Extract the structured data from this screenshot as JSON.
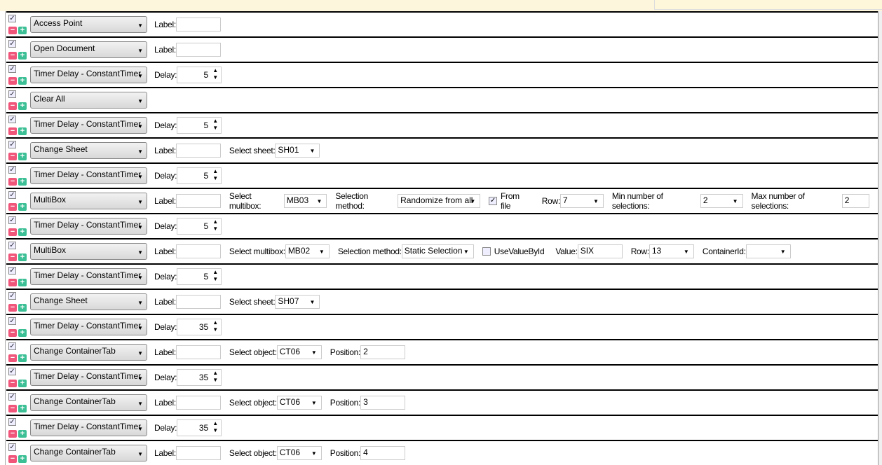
{
  "rows": [
    {
      "action": "Access Point",
      "fields": [
        {
          "type": "input",
          "label": "Label:",
          "value": "",
          "w": 64
        }
      ]
    },
    {
      "action": "Open Document",
      "fields": [
        {
          "type": "input",
          "label": "Label:",
          "value": "",
          "w": 64
        }
      ]
    },
    {
      "action": "Timer Delay - ConstantTimer",
      "fields": [
        {
          "type": "spin",
          "label": "Delay:",
          "value": "5"
        }
      ]
    },
    {
      "action": "Clear All",
      "fields": []
    },
    {
      "action": "Timer Delay - ConstantTimer",
      "fields": [
        {
          "type": "spin",
          "label": "Delay:",
          "value": "5"
        }
      ]
    },
    {
      "action": "Change Sheet",
      "fields": [
        {
          "type": "input",
          "label": "Label:",
          "value": "",
          "w": 64
        },
        {
          "type": "select",
          "label": "Select sheet:",
          "value": "SH01",
          "w": 64
        }
      ]
    },
    {
      "action": "Timer Delay - ConstantTimer",
      "fields": [
        {
          "type": "spin",
          "label": "Delay:",
          "value": "5"
        }
      ]
    },
    {
      "action": "MultiBox",
      "fields": [
        {
          "type": "input",
          "label": "Label:",
          "value": "",
          "w": 64
        },
        {
          "type": "select",
          "label": "Select multibox:",
          "value": "MB03",
          "w": 63
        },
        {
          "type": "select",
          "label": "Selection method:",
          "value": "Randomize from all",
          "w": 121
        },
        {
          "type": "checkbox",
          "label": "From file",
          "checked": true
        },
        {
          "type": "select",
          "label": "Row:",
          "value": "7",
          "w": 62
        },
        {
          "type": "select",
          "label": "Min number of selections:",
          "value": "2",
          "w": 62
        },
        {
          "type": "input",
          "label": "Max number of selections:",
          "value": "2",
          "w": 40
        }
      ]
    },
    {
      "action": "Timer Delay - ConstantTimer",
      "fields": [
        {
          "type": "spin",
          "label": "Delay:",
          "value": "5"
        }
      ]
    },
    {
      "action": "MultiBox",
      "fields": [
        {
          "type": "input",
          "label": "Label:",
          "value": "",
          "w": 64
        },
        {
          "type": "select",
          "label": "Select multibox:",
          "value": "MB02",
          "w": 63
        },
        {
          "type": "select",
          "label": "Selection method:",
          "value": "Static Selection",
          "w": 103
        },
        {
          "type": "checkbox",
          "label": "UseValueById",
          "checked": false
        },
        {
          "type": "input",
          "label": "Value:",
          "value": "SIX",
          "w": 64
        },
        {
          "type": "select",
          "label": "Row:",
          "value": "13",
          "w": 64
        },
        {
          "type": "select",
          "label": "ContainerId:",
          "value": "",
          "w": 64
        }
      ]
    },
    {
      "action": "Timer Delay - ConstantTimer",
      "fields": [
        {
          "type": "spin",
          "label": "Delay:",
          "value": "5"
        }
      ]
    },
    {
      "action": "Change Sheet",
      "fields": [
        {
          "type": "input",
          "label": "Label:",
          "value": "",
          "w": 64
        },
        {
          "type": "select",
          "label": "Select sheet:",
          "value": "SH07",
          "w": 64
        }
      ]
    },
    {
      "action": "Timer Delay - ConstantTimer",
      "fields": [
        {
          "type": "spin",
          "label": "Delay:",
          "value": "35"
        }
      ]
    },
    {
      "action": "Change ContainerTab",
      "fields": [
        {
          "type": "input",
          "label": "Label:",
          "value": "",
          "w": 64
        },
        {
          "type": "select",
          "label": "Select object:",
          "value": "CT06",
          "w": 64
        },
        {
          "type": "input",
          "label": "Position:",
          "value": "2",
          "w": 64
        }
      ]
    },
    {
      "action": "Timer Delay - ConstantTimer",
      "fields": [
        {
          "type": "spin",
          "label": "Delay:",
          "value": "35"
        }
      ]
    },
    {
      "action": "Change ContainerTab",
      "fields": [
        {
          "type": "input",
          "label": "Label:",
          "value": "",
          "w": 64
        },
        {
          "type": "select",
          "label": "Select object:",
          "value": "CT06",
          "w": 64
        },
        {
          "type": "input",
          "label": "Position:",
          "value": "3",
          "w": 64
        }
      ]
    },
    {
      "action": "Timer Delay - ConstantTimer",
      "fields": [
        {
          "type": "spin",
          "label": "Delay:",
          "value": "35"
        }
      ]
    },
    {
      "action": "Change ContainerTab",
      "fields": [
        {
          "type": "input",
          "label": "Label:",
          "value": "",
          "w": 64
        },
        {
          "type": "select",
          "label": "Select object:",
          "value": "CT06",
          "w": 64
        },
        {
          "type": "input",
          "label": "Position:",
          "value": "4",
          "w": 64
        }
      ]
    }
  ]
}
